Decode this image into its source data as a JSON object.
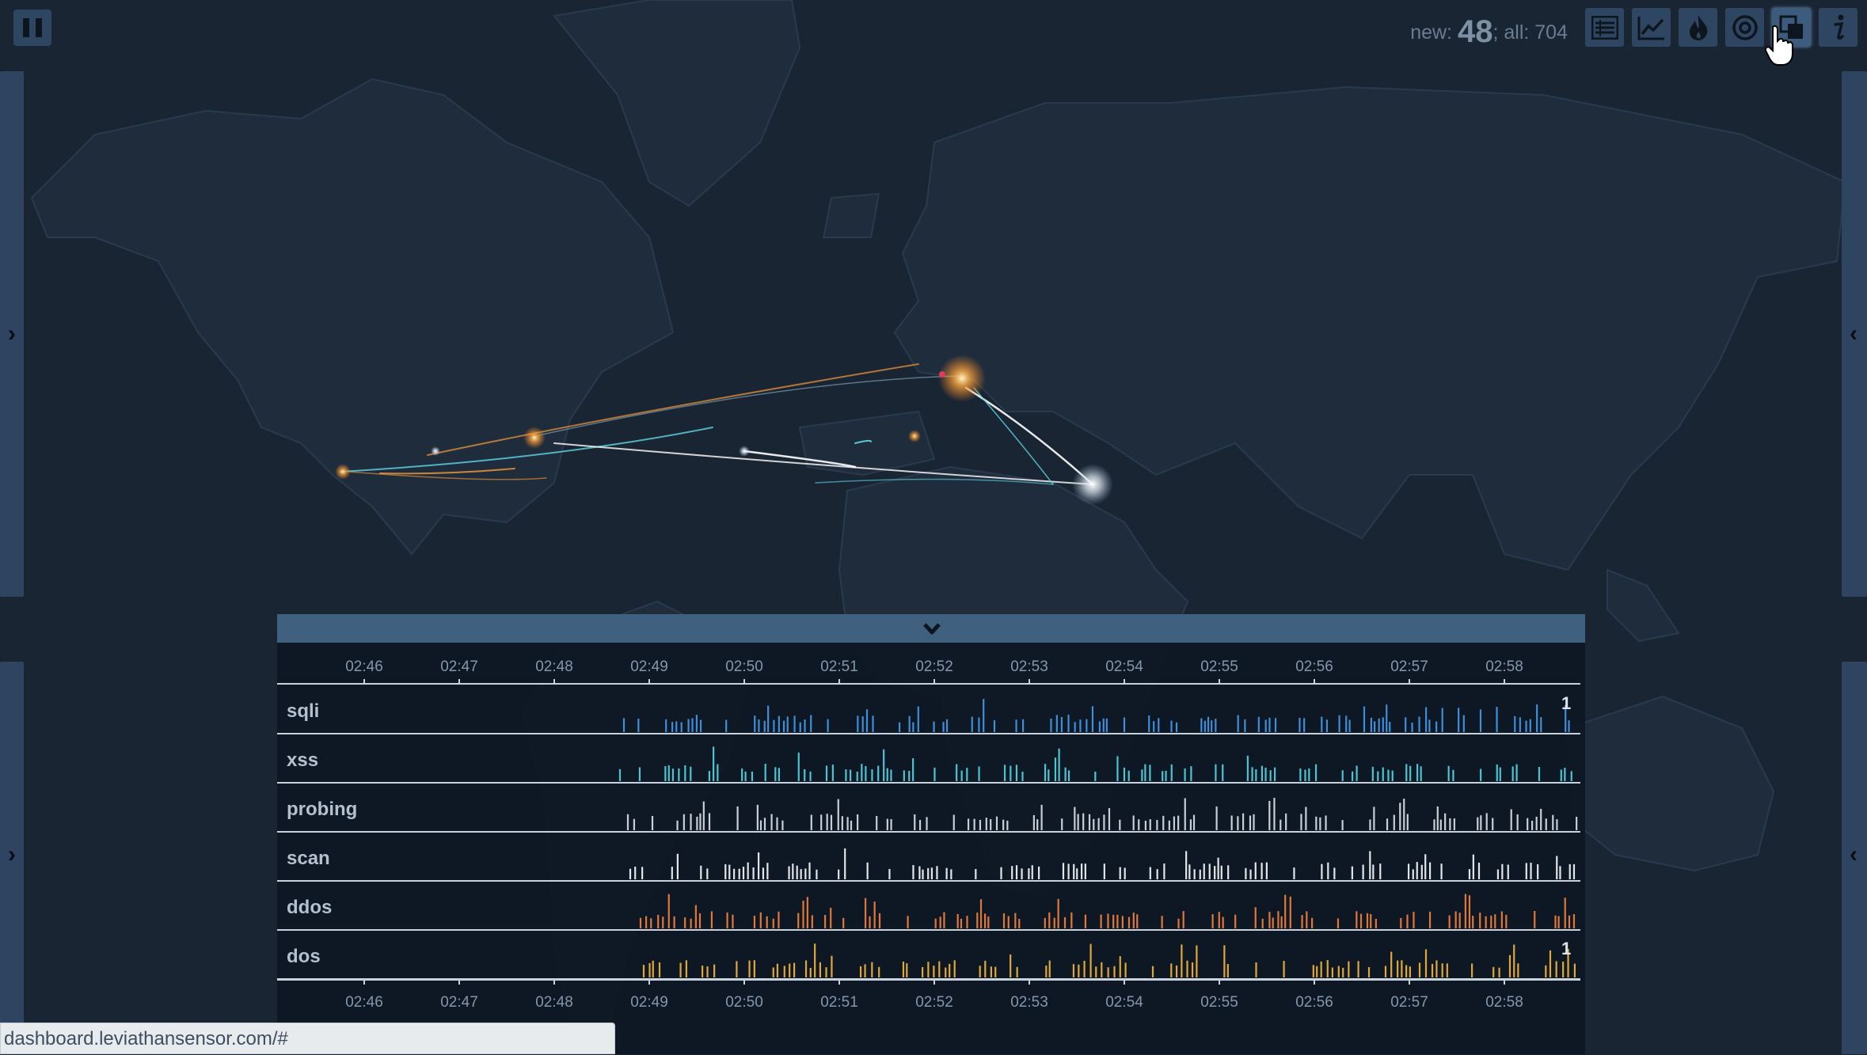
{
  "header": {
    "counter_new_label": "new:",
    "counter_new_value": "48",
    "counter_sep": ";",
    "counter_all_label": "all:",
    "counter_all_value": "704"
  },
  "toolbar": {
    "buttons": [
      {
        "icon": "list-icon",
        "active": false
      },
      {
        "icon": "line-chart-icon",
        "active": false
      },
      {
        "icon": "flame-icon",
        "active": false
      },
      {
        "icon": "target-icon",
        "active": false
      },
      {
        "icon": "windows-layout-icon",
        "active": true
      },
      {
        "icon": "info-icon",
        "active": false
      }
    ]
  },
  "side_tabs": {
    "left_chevron": "›",
    "right_chevron": "‹"
  },
  "timeline": {
    "ticks": [
      "02:46",
      "02:47",
      "02:48",
      "02:49",
      "02:50",
      "02:51",
      "02:52",
      "02:53",
      "02:54",
      "02:55",
      "02:56",
      "02:57",
      "02:58"
    ],
    "rows": [
      {
        "label": "sqli",
        "color": "#3f8fd8",
        "count": "1",
        "start": 0.265
      },
      {
        "label": "xss",
        "color": "#4cc4d2",
        "count": "",
        "start": 0.262
      },
      {
        "label": "probing",
        "color": "#c9cfd6",
        "count": "",
        "start": 0.268
      },
      {
        "label": "scan",
        "color": "#e2e6ea",
        "count": "",
        "start": 0.27
      },
      {
        "label": "ddos",
        "color": "#e0783a",
        "count": "",
        "start": 0.278
      },
      {
        "label": "dos",
        "color": "#e0a83a",
        "count": "1",
        "start": 0.28
      }
    ]
  },
  "status_bar": {
    "url": "dashboard.leviathansensor.com/#"
  },
  "colors": {
    "background": "#1a2533",
    "land": "#1f2c3c",
    "panel_header": "#40607f",
    "arc_white": "#ffffff",
    "arc_cyan": "#5fd6e6",
    "arc_orange": "#f29a3a"
  }
}
